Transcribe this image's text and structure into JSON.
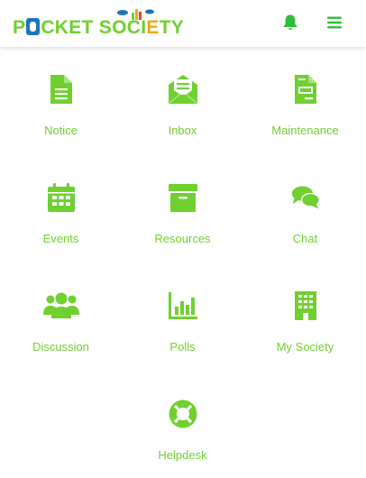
{
  "header": {
    "logo_part1": "P",
    "logo_part2": "CKET SOCI",
    "logo_part3": "TY",
    "notification_icon": "bell-icon",
    "menu_icon": "hamburger-menu-icon"
  },
  "colors": {
    "accent": "#6fd02f",
    "logo_blue": "#1b75bb"
  },
  "tiles": [
    {
      "label": "Notice",
      "icon": "document-icon"
    },
    {
      "label": "Inbox",
      "icon": "envelope-open-icon"
    },
    {
      "label": "Maintenance",
      "icon": "invoice-icon"
    },
    {
      "label": "Events",
      "icon": "calendar-icon"
    },
    {
      "label": "Resources",
      "icon": "archive-box-icon"
    },
    {
      "label": "Chat",
      "icon": "chat-bubbles-icon"
    },
    {
      "label": "Discussion",
      "icon": "users-group-icon"
    },
    {
      "label": "Polls",
      "icon": "bar-chart-icon"
    },
    {
      "label": "My Society",
      "icon": "building-icon"
    },
    {
      "label": "Helpdesk",
      "icon": "life-ring-icon"
    }
  ]
}
